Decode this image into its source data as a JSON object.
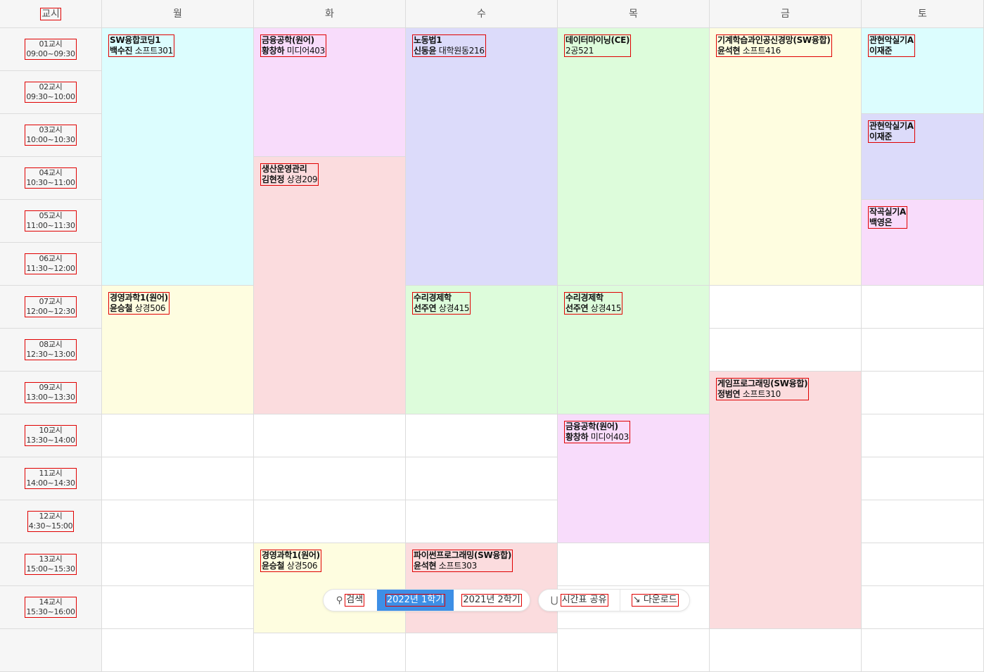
{
  "header": {
    "period_label": "교시",
    "days": [
      "월",
      "화",
      "수",
      "목",
      "금",
      "토"
    ]
  },
  "periods": [
    {
      "name": "01교시",
      "time": "09:00~09:30"
    },
    {
      "name": "02교시",
      "time": "09:30~10:00"
    },
    {
      "name": "03교시",
      "time": "10:00~10:30"
    },
    {
      "name": "04교시",
      "time": "10:30~11:00"
    },
    {
      "name": "05교시",
      "time": "11:00~11:30"
    },
    {
      "name": "06교시",
      "time": "11:30~12:00"
    },
    {
      "name": "07교시",
      "time": "12:00~12:30"
    },
    {
      "name": "08교시",
      "time": "12:30~13:00"
    },
    {
      "name": "09교시",
      "time": "13:00~13:30"
    },
    {
      "name": "10교시",
      "time": "13:30~14:00"
    },
    {
      "name": "11교시",
      "time": "14:00~14:30"
    },
    {
      "name": "12교시",
      "time": "4:30~15:00"
    },
    {
      "name": "13교시",
      "time": "15:00~15:30"
    },
    {
      "name": "14교시",
      "time": "15:30~16:00"
    }
  ],
  "courses": [
    {
      "day": 0,
      "start": 1,
      "span": 6,
      "title": "SW융합코딩1",
      "professor": "백수진",
      "room": "소프트301",
      "color": "#dcfdfe"
    },
    {
      "day": 0,
      "start": 7,
      "span": 3,
      "title": "경영과학1(원어)",
      "professor": "윤승철",
      "room": "상경506",
      "color": "#fefde0"
    },
    {
      "day": 1,
      "start": 1,
      "span": 3,
      "title": "금융공학(원어)",
      "professor": "황창하",
      "room": "미디어403",
      "color": "#f8dcfb"
    },
    {
      "day": 1,
      "start": 4,
      "span": 6,
      "title": "생산운영관리",
      "professor": "김현정",
      "room": "상경209",
      "color": "#fbdcde"
    },
    {
      "day": 1,
      "start": 13,
      "span": 3,
      "title": "경영과학1(원어)",
      "professor": "윤승철",
      "room": "상경506",
      "color": "#fefde0"
    },
    {
      "day": 2,
      "start": 1,
      "span": 6,
      "title": "노동법1",
      "professor": "신동윤",
      "room": "대학원동216",
      "color": "#dcdbfa"
    },
    {
      "day": 2,
      "start": 7,
      "span": 3,
      "title": "수리경제학",
      "professor": "선주연",
      "room": "상경415",
      "color": "#ddfcdb"
    },
    {
      "day": 2,
      "start": 13,
      "span": 3,
      "title": "파이썬프로그래밍(SW융합)",
      "professor": "윤석현",
      "room": "소프트303",
      "color": "#fbdcde"
    },
    {
      "day": 3,
      "start": 1,
      "span": 6,
      "title": "데이터마이닝(CE)",
      "professor": "",
      "room": "2공521",
      "color": "#ddfcdb"
    },
    {
      "day": 3,
      "start": 7,
      "span": 3,
      "title": "수리경제학",
      "professor": "선주연",
      "room": "상경415",
      "color": "#ddfcdb"
    },
    {
      "day": 3,
      "start": 10,
      "span": 3,
      "title": "금융공학(원어)",
      "professor": "황창하",
      "room": "미디어403",
      "color": "#f8dcfb"
    },
    {
      "day": 4,
      "start": 1,
      "span": 6,
      "title": "기계학습과인공신경망(SW융합)",
      "professor": "윤석현",
      "room": "소프트416",
      "color": "#fefde0"
    },
    {
      "day": 4,
      "start": 9,
      "span": 6,
      "title": "게임프로그래밍(SW융합)",
      "professor": "정범연",
      "room": "소프트310",
      "color": "#fbdcde"
    },
    {
      "day": 5,
      "start": 1,
      "span": 2,
      "title": "관현악실기A",
      "professor": "이재준",
      "room": "",
      "color": "#dcfdfe"
    },
    {
      "day": 5,
      "start": 3,
      "span": 2,
      "title": "관현악실기A",
      "professor": "이재준",
      "room": "",
      "color": "#dcdbfa"
    },
    {
      "day": 5,
      "start": 5,
      "span": 2,
      "title": "작곡실기A",
      "professor": "백영은",
      "room": "",
      "color": "#f8dcfb"
    }
  ],
  "toolbar": {
    "search_label": "검색",
    "semester_current": "2022년 1학기",
    "semester_previous": "2021년 2학기",
    "share_label": "시간표 공유",
    "download_label": "다운로드"
  }
}
